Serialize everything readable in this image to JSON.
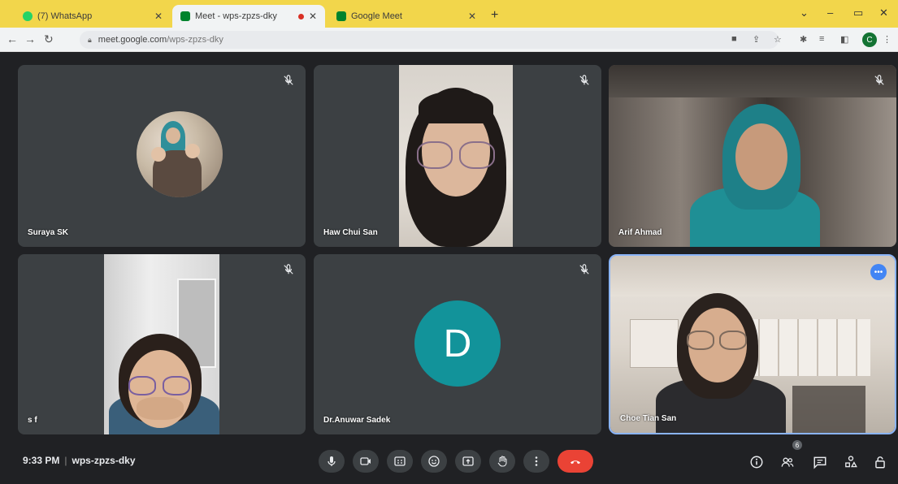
{
  "browser": {
    "tabs": [
      {
        "title": "(7) WhatsApp",
        "favicon_color": "#25d366"
      },
      {
        "title": "Meet - wps-zpzs-dky",
        "favicon_color": "#00832d"
      },
      {
        "title": "Google Meet",
        "favicon_color": "#00832d"
      }
    ],
    "new_tab_label": "+",
    "url_host": "meet.google.com",
    "url_path": "/wps-zpzs-dky",
    "profile_initial": "C"
  },
  "participants": [
    {
      "name": "Suraya SK",
      "muted": true
    },
    {
      "name": "Haw Chui San",
      "muted": true
    },
    {
      "name": "Arif Ahmad",
      "muted": true
    },
    {
      "name": "s f",
      "muted": true
    },
    {
      "name": "Dr.Anuwar Sadek",
      "muted": true,
      "avatar_letter": "D"
    },
    {
      "name": "Choe Tian San",
      "muted": false
    }
  ],
  "meeting": {
    "time": "9:33 PM",
    "separator": "|",
    "code": "wps-zpzs-dky",
    "people_count": "6"
  },
  "colors": {
    "accent": "#8ab4f8",
    "end_call": "#ea4335",
    "tile_bg": "#3c4043",
    "page_bg": "#202124",
    "tab_strip": "#f2d64b"
  },
  "icons": {
    "controls": [
      "mic-icon",
      "camera-icon",
      "captions-icon",
      "emoji-icon",
      "present-icon",
      "raise-hand-icon",
      "more-options-icon",
      "end-call-icon"
    ],
    "right_controls": [
      "info-icon",
      "people-icon",
      "chat-icon",
      "activities-icon",
      "host-controls-icon"
    ]
  }
}
